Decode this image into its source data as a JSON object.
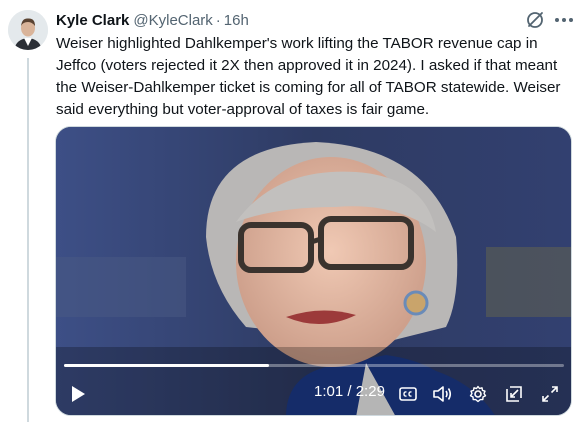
{
  "tweet": {
    "author_name": "Kyle Clark",
    "author_handle": "@KyleClark",
    "separator": "·",
    "time_ago": "16h",
    "text": "Weiser highlighted Dahlkemper's work lifting the TABOR revenue cap in Jeffco (voters rejected it 2X then approved it in 2024). I asked if that meant the Weiser-Dahlkemper ticket is coming for all of TABOR statewide. Weiser said everything but voter-approval of taxes is fair game."
  },
  "video": {
    "current_time": "1:01",
    "time_divider": "/",
    "duration": "2:29",
    "progress": 0.41,
    "icons": [
      "play-icon",
      "captions-icon",
      "volume-icon",
      "settings-icon",
      "pop-out-icon",
      "fullscreen-icon"
    ]
  },
  "colors": {
    "text_primary": "#0f1419",
    "text_secondary": "#536471",
    "thread_line": "#cfd9de"
  }
}
